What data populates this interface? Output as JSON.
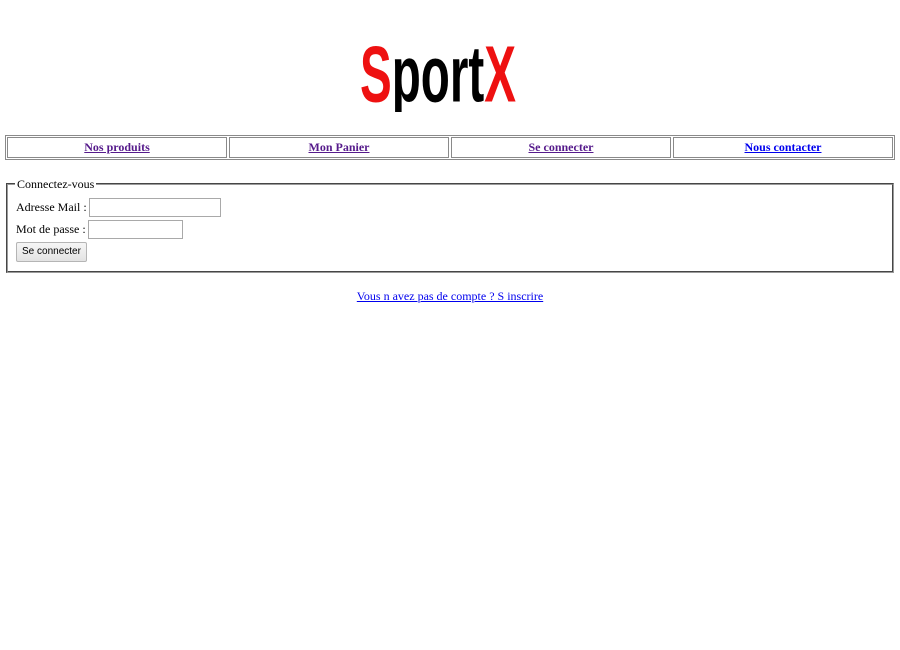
{
  "brand": {
    "logo_text_first": "S",
    "logo_text_middle": "port",
    "logo_text_last": "X",
    "logo_red": "#ee1111",
    "logo_black": "#000000"
  },
  "nav": {
    "items": [
      {
        "label": "Nos produits",
        "state": "visited"
      },
      {
        "label": "Mon Panier",
        "state": "visited"
      },
      {
        "label": "Se connecter",
        "state": "visited"
      },
      {
        "label": "Nous contacter",
        "state": "unvisited"
      }
    ],
    "visited_color": "#551a8b",
    "link_color": "#0000ee"
  },
  "login": {
    "legend": "Connectez-vous",
    "email_label": "Adresse Mail :",
    "email_value": "",
    "password_label": "Mot de passe :",
    "password_value": "",
    "submit_label": "Se connecter"
  },
  "register": {
    "link_text": "Vous n avez pas de compte ? S inscrire"
  }
}
